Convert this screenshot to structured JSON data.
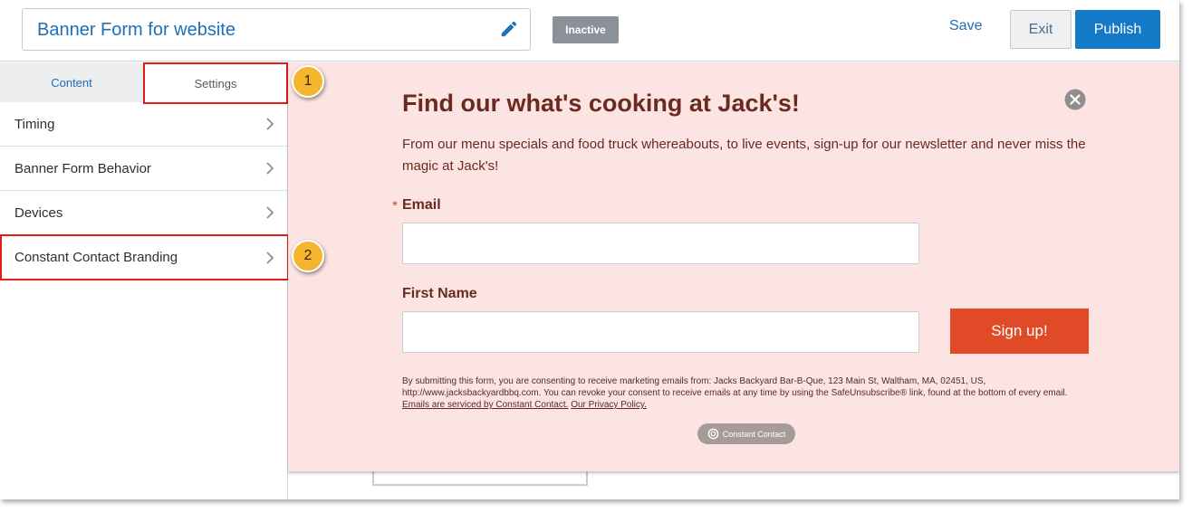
{
  "header": {
    "form_title": "Banner Form for website",
    "status": "Inactive",
    "save_label": "Save",
    "exit_label": "Exit",
    "publish_label": "Publish",
    "icons": {
      "edit": "pencil-icon"
    },
    "colors": {
      "primary": "#1479c6",
      "status_badge": "#8b9198"
    }
  },
  "sidebar": {
    "tabs": [
      {
        "label": "Content",
        "selected": false
      },
      {
        "label": "Settings",
        "selected": true
      }
    ],
    "items": [
      {
        "label": "Timing"
      },
      {
        "label": "Banner Form Behavior"
      },
      {
        "label": "Devices"
      },
      {
        "label": "Constant Contact Branding"
      }
    ]
  },
  "callouts": [
    "1",
    "2"
  ],
  "banner": {
    "title": "Find our what's cooking at Jack's!",
    "description": "From our menu specials and food truck whereabouts, to live events, sign-up for our newsletter and never miss the magic at Jack's!",
    "required_marker": "*",
    "email_label": "Email",
    "email_value": "",
    "first_name_label": "First Name",
    "first_name_value": "",
    "signup_label": "Sign up!",
    "legal_text": "By submitting this form, you are consenting to receive marketing emails from: Jacks Backyard Bar-B-Que, 123 Main St, Waltham, MA, 02451, US, http://www.jacksbackyardbbq.com. You can revoke your consent to receive emails at any time by using the SafeUnsubscribe® link, found at the bottom of every email.",
    "legal_link_1": "Emails are serviced by Constant Contact.",
    "legal_link_2": "Our Privacy Policy.",
    "branding_badge": "Constant Contact",
    "colors": {
      "background": "#fbe4e2",
      "text": "#6a2a20",
      "button": "#e04a27"
    }
  }
}
